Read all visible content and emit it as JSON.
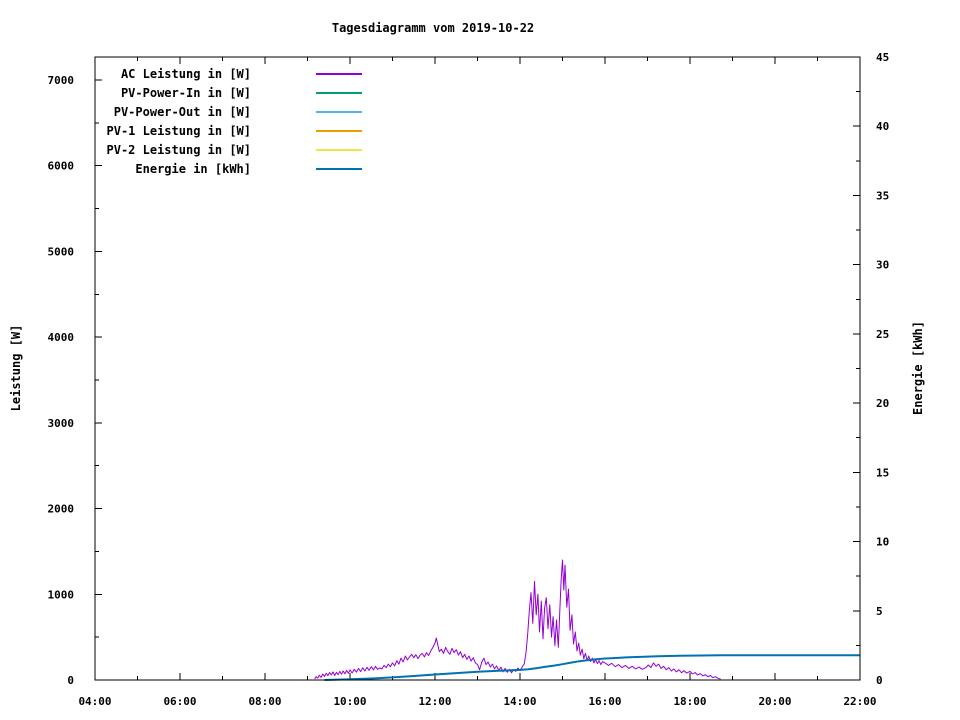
{
  "title": "Tagesdiagramm vom 2019-10-22",
  "colors": {
    "background": "#ffffff",
    "foreground": "#000000",
    "ac_leistung": "#9400d3",
    "pv_power_in": "#009e73",
    "pv_power_out": "#56b4e9",
    "pv1_leistung": "#e69f00",
    "pv2_leistung": "#f0e442",
    "energie": "#0072b2"
  },
  "axes": {
    "y_left": {
      "label": "Leistung [W]",
      "tick_values": [
        0,
        1000,
        2000,
        3000,
        4000,
        5000,
        6000,
        7000
      ],
      "tick_labels": [
        "0",
        "1000",
        "2000",
        "3000",
        "4000",
        "5000",
        "6000",
        "7000"
      ],
      "minor_tick_values": [
        500,
        1500,
        2500,
        3500,
        4500,
        5500,
        6500
      ],
      "range": [
        0,
        7270
      ]
    },
    "y_right": {
      "label": "Energie [kWh]",
      "tick_values": [
        0,
        5,
        10,
        15,
        20,
        25,
        30,
        35,
        40,
        45
      ],
      "tick_labels": [
        "0",
        "5",
        "10",
        "15",
        "20",
        "25",
        "30",
        "35",
        "40",
        "45"
      ],
      "minor_tick_values": [
        2.5,
        7.5,
        12.5,
        17.5,
        22.5,
        27.5,
        32.5,
        37.5,
        42.5
      ],
      "range": [
        0,
        45
      ]
    },
    "x": {
      "tick_hours": [
        4,
        6,
        8,
        10,
        12,
        14,
        16,
        18,
        20,
        22
      ],
      "tick_labels": [
        "04:00",
        "06:00",
        "08:00",
        "10:00",
        "12:00",
        "14:00",
        "16:00",
        "18:00",
        "20:00",
        "22:00"
      ],
      "minor_tick_hours": [
        5,
        7,
        9,
        11,
        13,
        15,
        17,
        19,
        21
      ],
      "range_hours": [
        4,
        22
      ]
    }
  },
  "legend": {
    "items": [
      {
        "label": "AC Leistung in [W]",
        "color": "#9400d3"
      },
      {
        "label": "PV-Power-In in [W]",
        "color": "#009e73"
      },
      {
        "label": "PV-Power-Out in [W]",
        "color": "#56b4e9"
      },
      {
        "label": "PV-1 Leistung in [W]",
        "color": "#e69f00"
      },
      {
        "label": "PV-2 Leistung in [W]",
        "color": "#f0e442"
      },
      {
        "label": "Energie in [kWh]",
        "color": "#0072b2"
      }
    ]
  },
  "chart_data": {
    "type": "line",
    "title": "Tagesdiagramm vom 2019-10-22",
    "xlabel": "",
    "ylabel": "Leistung [W]",
    "y2label": "Energie [kWh]",
    "x_unit": "hour_of_day",
    "xlim": [
      4,
      22
    ],
    "ylim_left": [
      0,
      7270
    ],
    "ylim_right": [
      0,
      45
    ],
    "grid": false,
    "legend_position": "top-left-inside",
    "series": [
      {
        "name": "AC Leistung in [W]",
        "color": "#9400d3",
        "axis": "left",
        "width": 1,
        "points": [
          [
            9.17,
            12
          ],
          [
            9.2,
            38
          ],
          [
            9.24,
            22
          ],
          [
            9.28,
            55
          ],
          [
            9.32,
            30
          ],
          [
            9.36,
            70
          ],
          [
            9.4,
            42
          ],
          [
            9.44,
            78
          ],
          [
            9.48,
            50
          ],
          [
            9.52,
            88
          ],
          [
            9.56,
            58
          ],
          [
            9.6,
            95
          ],
          [
            9.64,
            52
          ],
          [
            9.68,
            90
          ],
          [
            9.72,
            62
          ],
          [
            9.76,
            100
          ],
          [
            9.8,
            68
          ],
          [
            9.84,
            105
          ],
          [
            9.88,
            72
          ],
          [
            9.92,
            112
          ],
          [
            9.96,
            78
          ],
          [
            10.0,
            118
          ],
          [
            10.05,
            82
          ],
          [
            10.1,
            125
          ],
          [
            10.15,
            92
          ],
          [
            10.2,
            135
          ],
          [
            10.25,
            98
          ],
          [
            10.3,
            142
          ],
          [
            10.35,
            105
          ],
          [
            10.4,
            148
          ],
          [
            10.45,
            112
          ],
          [
            10.5,
            155
          ],
          [
            10.55,
            118
          ],
          [
            10.6,
            160
          ],
          [
            10.65,
            125
          ],
          [
            10.7,
            140
          ],
          [
            10.75,
            130
          ],
          [
            10.8,
            170
          ],
          [
            10.85,
            145
          ],
          [
            10.9,
            185
          ],
          [
            10.95,
            155
          ],
          [
            11.0,
            200
          ],
          [
            11.05,
            165
          ],
          [
            11.1,
            225
          ],
          [
            11.15,
            185
          ],
          [
            11.2,
            255
          ],
          [
            11.25,
            210
          ],
          [
            11.3,
            280
          ],
          [
            11.35,
            235
          ],
          [
            11.4,
            270
          ],
          [
            11.45,
            300
          ],
          [
            11.5,
            260
          ],
          [
            11.55,
            295
          ],
          [
            11.6,
            250
          ],
          [
            11.65,
            290
          ],
          [
            11.7,
            310
          ],
          [
            11.75,
            270
          ],
          [
            11.8,
            320
          ],
          [
            11.85,
            285
          ],
          [
            11.9,
            340
          ],
          [
            11.95,
            380
          ],
          [
            12.0,
            430
          ],
          [
            12.03,
            490
          ],
          [
            12.06,
            420
          ],
          [
            12.1,
            330
          ],
          [
            12.15,
            360
          ],
          [
            12.2,
            310
          ],
          [
            12.25,
            380
          ],
          [
            12.3,
            330
          ],
          [
            12.35,
            300
          ],
          [
            12.4,
            370
          ],
          [
            12.45,
            320
          ],
          [
            12.5,
            355
          ],
          [
            12.55,
            290
          ],
          [
            12.6,
            330
          ],
          [
            12.65,
            260
          ],
          [
            12.7,
            300
          ],
          [
            12.75,
            240
          ],
          [
            12.8,
            280
          ],
          [
            12.85,
            220
          ],
          [
            12.9,
            260
          ],
          [
            12.95,
            200
          ],
          [
            13.0,
            180
          ],
          [
            13.05,
            120
          ],
          [
            13.1,
            210
          ],
          [
            13.15,
            255
          ],
          [
            13.2,
            180
          ],
          [
            13.25,
            210
          ],
          [
            13.3,
            150
          ],
          [
            13.35,
            185
          ],
          [
            13.4,
            130
          ],
          [
            13.45,
            165
          ],
          [
            13.5,
            110
          ],
          [
            13.55,
            150
          ],
          [
            13.6,
            95
          ],
          [
            13.65,
            135
          ],
          [
            13.7,
            90
          ],
          [
            13.75,
            125
          ],
          [
            13.8,
            85
          ],
          [
            13.85,
            120
          ],
          [
            13.9,
            100
          ],
          [
            13.95,
            140
          ],
          [
            14.0,
            110
          ],
          [
            14.05,
            150
          ],
          [
            14.1,
            190
          ],
          [
            14.14,
            320
          ],
          [
            14.18,
            520
          ],
          [
            14.22,
            820
          ],
          [
            14.26,
            1020
          ],
          [
            14.3,
            660
          ],
          [
            14.34,
            1150
          ],
          [
            14.38,
            760
          ],
          [
            14.42,
            1000
          ],
          [
            14.46,
            560
          ],
          [
            14.5,
            920
          ],
          [
            14.54,
            480
          ],
          [
            14.58,
            840
          ],
          [
            14.62,
            960
          ],
          [
            14.66,
            600
          ],
          [
            14.7,
            880
          ],
          [
            14.74,
            500
          ],
          [
            14.78,
            740
          ],
          [
            14.82,
            400
          ],
          [
            14.86,
            700
          ],
          [
            14.9,
            380
          ],
          [
            14.94,
            860
          ],
          [
            14.97,
            1180
          ],
          [
            15.0,
            1400
          ],
          [
            15.03,
            1050
          ],
          [
            15.06,
            1340
          ],
          [
            15.1,
            850
          ],
          [
            15.14,
            1060
          ],
          [
            15.18,
            580
          ],
          [
            15.22,
            760
          ],
          [
            15.26,
            420
          ],
          [
            15.3,
            560
          ],
          [
            15.34,
            340
          ],
          [
            15.38,
            430
          ],
          [
            15.42,
            290
          ],
          [
            15.46,
            360
          ],
          [
            15.5,
            250
          ],
          [
            15.54,
            310
          ],
          [
            15.58,
            230
          ],
          [
            15.62,
            280
          ],
          [
            15.66,
            215
          ],
          [
            15.7,
            255
          ],
          [
            15.74,
            200
          ],
          [
            15.78,
            240
          ],
          [
            15.82,
            190
          ],
          [
            15.86,
            225
          ],
          [
            15.9,
            180
          ],
          [
            15.94,
            215
          ],
          [
            16.0,
            200
          ],
          [
            16.08,
            170
          ],
          [
            16.16,
            195
          ],
          [
            16.24,
            155
          ],
          [
            16.32,
            180
          ],
          [
            16.4,
            145
          ],
          [
            16.48,
            170
          ],
          [
            16.56,
            135
          ],
          [
            16.64,
            160
          ],
          [
            16.72,
            130
          ],
          [
            16.8,
            150
          ],
          [
            16.88,
            125
          ],
          [
            16.96,
            145
          ],
          [
            17.02,
            175
          ],
          [
            17.08,
            145
          ],
          [
            17.14,
            200
          ],
          [
            17.2,
            160
          ],
          [
            17.26,
            185
          ],
          [
            17.32,
            135
          ],
          [
            17.38,
            160
          ],
          [
            17.44,
            120
          ],
          [
            17.5,
            145
          ],
          [
            17.56,
            105
          ],
          [
            17.62,
            130
          ],
          [
            17.68,
            95
          ],
          [
            17.74,
            120
          ],
          [
            17.8,
            85
          ],
          [
            17.86,
            110
          ],
          [
            17.92,
            80
          ],
          [
            18.0,
            100
          ],
          [
            18.06,
            70
          ],
          [
            18.12,
            88
          ],
          [
            18.18,
            58
          ],
          [
            18.24,
            75
          ],
          [
            18.3,
            48
          ],
          [
            18.36,
            62
          ],
          [
            18.42,
            38
          ],
          [
            18.48,
            52
          ],
          [
            18.54,
            28
          ],
          [
            18.6,
            38
          ],
          [
            18.66,
            20
          ],
          [
            18.72,
            12
          ]
        ]
      },
      {
        "name": "Energie in [kWh]",
        "color": "#0072b2",
        "axis": "right",
        "width": 2,
        "points": [
          [
            9.4,
            0.0
          ],
          [
            10.0,
            0.05
          ],
          [
            10.5,
            0.11
          ],
          [
            11.0,
            0.19
          ],
          [
            11.5,
            0.29
          ],
          [
            12.0,
            0.4
          ],
          [
            12.5,
            0.5
          ],
          [
            13.0,
            0.6
          ],
          [
            13.5,
            0.67
          ],
          [
            14.0,
            0.73
          ],
          [
            14.2,
            0.78
          ],
          [
            14.4,
            0.86
          ],
          [
            14.6,
            0.95
          ],
          [
            14.8,
            1.04
          ],
          [
            15.0,
            1.14
          ],
          [
            15.2,
            1.26
          ],
          [
            15.4,
            1.36
          ],
          [
            15.6,
            1.44
          ],
          [
            15.8,
            1.5
          ],
          [
            16.0,
            1.55
          ],
          [
            16.25,
            1.59
          ],
          [
            16.5,
            1.63
          ],
          [
            16.75,
            1.66
          ],
          [
            17.0,
            1.69
          ],
          [
            17.25,
            1.71
          ],
          [
            17.5,
            1.73
          ],
          [
            17.75,
            1.75
          ],
          [
            18.0,
            1.76
          ],
          [
            18.25,
            1.77
          ],
          [
            18.5,
            1.78
          ],
          [
            18.75,
            1.79
          ],
          [
            19.0,
            1.79
          ],
          [
            22.0,
            1.79
          ]
        ]
      }
    ],
    "series_without_visible_curve": [
      "PV-Power-In in [W]",
      "PV-Power-Out in [W]",
      "PV-1 Leistung in [W]",
      "PV-2 Leistung in [W]"
    ]
  }
}
